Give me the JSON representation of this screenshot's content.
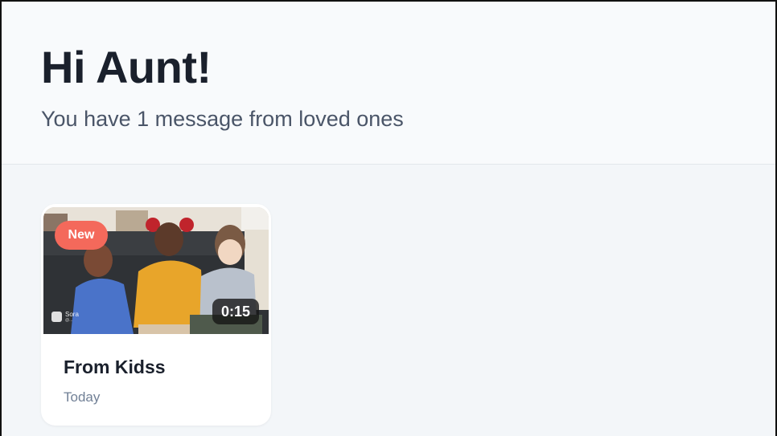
{
  "header": {
    "greeting": "Hi Aunt!",
    "subtitle": "You have 1 message from loved ones"
  },
  "messages": [
    {
      "badge": "New",
      "duration": "0:15",
      "title": "From Kidss",
      "date": "Today",
      "watermark": {
        "title": "Sora",
        "subtitle": "@..."
      }
    }
  ],
  "colors": {
    "badge_new": "#f4695b",
    "title_text": "#1a202c",
    "subtitle_text": "#4a5568",
    "page_background": "#f3f6f9"
  }
}
